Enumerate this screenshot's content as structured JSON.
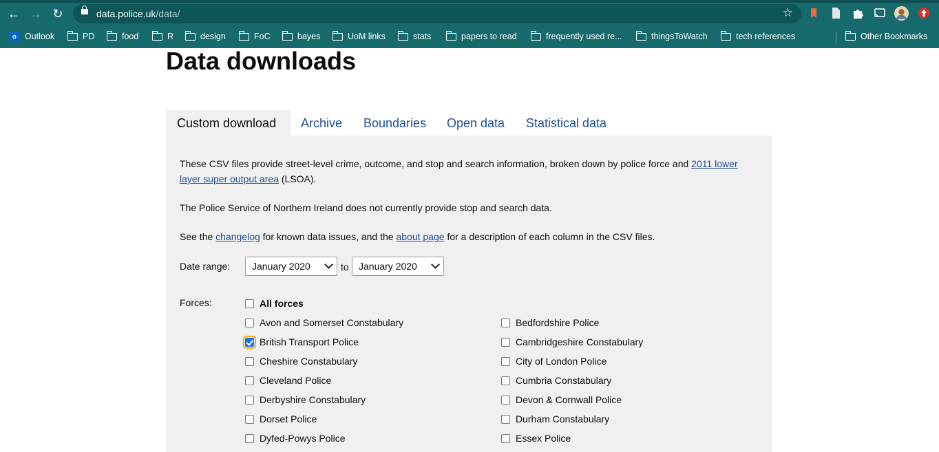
{
  "browser": {
    "url_host": "data.police.uk",
    "url_path": "/data/",
    "bookmarks": [
      "Outlook",
      "PD",
      "food",
      "R",
      "design",
      "FoC",
      "bayes",
      "UoM links",
      "stats",
      "papers to read",
      "frequently used re...",
      "thingsToWatch",
      "tech references"
    ],
    "other_bookmarks": "Other Bookmarks",
    "outlook_badge": "o",
    "theme_color": "#166a6c"
  },
  "page": {
    "title": "Data downloads",
    "tabs": [
      "Custom download",
      "Archive",
      "Boundaries",
      "Open data",
      "Statistical data"
    ],
    "active_tab": "Custom download",
    "intro": {
      "text1": "These CSV files provide street-level crime, outcome, and stop and search information, broken down by police force and ",
      "link1": "2011 lower layer super output area",
      "text2": " (LSOA)."
    },
    "psni_note": "The Police Service of Northern Ireland does not currently provide stop and search data.",
    "changelog_note": {
      "text1": "See the ",
      "link1": "changelog",
      "text2": " for known data issues, and the ",
      "link2": "about page",
      "text3": " for a description of each column in the CSV files."
    },
    "date_range": {
      "label": "Date range:",
      "from": "January 2020",
      "to_label": "to",
      "to": "January 2020"
    },
    "forces": {
      "label": "Forces:",
      "all_label": "All forces",
      "left": [
        {
          "name": "Avon and Somerset Constabulary",
          "checked": false
        },
        {
          "name": "British Transport Police",
          "checked": true
        },
        {
          "name": "Cheshire Constabulary",
          "checked": false
        },
        {
          "name": "Cleveland Police",
          "checked": false
        },
        {
          "name": "Derbyshire Constabulary",
          "checked": false
        },
        {
          "name": "Dorset Police",
          "checked": false
        },
        {
          "name": "Dyfed-Powys Police",
          "checked": false
        }
      ],
      "right": [
        {
          "name": "Bedfordshire Police",
          "checked": false
        },
        {
          "name": "Cambridgeshire Constabulary",
          "checked": false
        },
        {
          "name": "City of London Police",
          "checked": false
        },
        {
          "name": "Cumbria Constabulary",
          "checked": false
        },
        {
          "name": "Devon & Cornwall Police",
          "checked": false
        },
        {
          "name": "Durham Constabulary",
          "checked": false
        },
        {
          "name": "Essex Police",
          "checked": false
        }
      ]
    },
    "colors": {
      "link": "#1d4c96",
      "panel": "#f0f0f0",
      "checkbox_checked": "#1a73e8",
      "focus_ring": "#f5a623"
    }
  }
}
